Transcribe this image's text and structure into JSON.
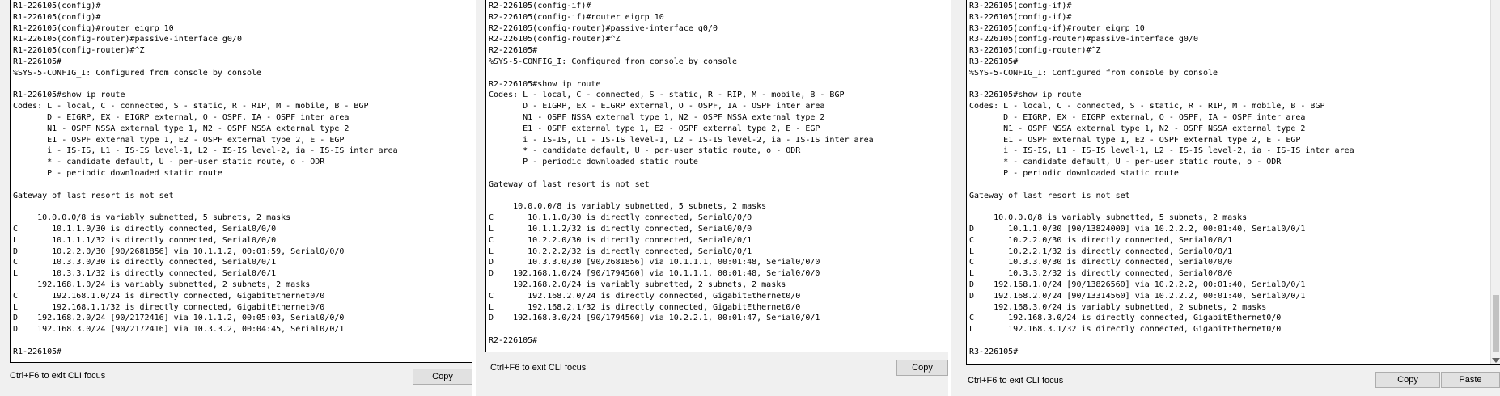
{
  "panels": [
    {
      "id": "R1",
      "terminal_lines": [
        "R1-226105(config)#",
        "R1-226105(config)#",
        "R1-226105(config)#router eigrp 10",
        "R1-226105(config-router)#passive-interface g0/0",
        "R1-226105(config-router)#^Z",
        "R1-226105#",
        "%SYS-5-CONFIG_I: Configured from console by console",
        "",
        "R1-226105#show ip route",
        "Codes: L - local, C - connected, S - static, R - RIP, M - mobile, B - BGP",
        "       D - EIGRP, EX - EIGRP external, O - OSPF, IA - OSPF inter area",
        "       N1 - OSPF NSSA external type 1, N2 - OSPF NSSA external type 2",
        "       E1 - OSPF external type 1, E2 - OSPF external type 2, E - EGP",
        "       i - IS-IS, L1 - IS-IS level-1, L2 - IS-IS level-2, ia - IS-IS inter area",
        "       * - candidate default, U - per-user static route, o - ODR",
        "       P - periodic downloaded static route",
        "",
        "Gateway of last resort is not set",
        "",
        "     10.0.0.0/8 is variably subnetted, 5 subnets, 2 masks",
        "C       10.1.1.0/30 is directly connected, Serial0/0/0",
        "L       10.1.1.1/32 is directly connected, Serial0/0/0",
        "D       10.2.2.0/30 [90/2681856] via 10.1.1.2, 00:01:59, Serial0/0/0",
        "C       10.3.3.0/30 is directly connected, Serial0/0/1",
        "L       10.3.3.1/32 is directly connected, Serial0/0/1",
        "     192.168.1.0/24 is variably subnetted, 2 subnets, 2 masks",
        "C       192.168.1.0/24 is directly connected, GigabitEthernet0/0",
        "L       192.168.1.1/32 is directly connected, GigabitEthernet0/0",
        "D    192.168.2.0/24 [90/2172416] via 10.1.1.2, 00:05:03, Serial0/0/0",
        "D    192.168.3.0/24 [90/2172416] via 10.3.3.2, 00:04:45, Serial0/0/1",
        "",
        "R1-226105#"
      ],
      "hint": "Ctrl+F6 to exit CLI focus",
      "copy_label": "Copy"
    },
    {
      "id": "R2",
      "terminal_lines": [
        "R2-226105(config-if)#",
        "R2-226105(config-if)#router eigrp 10",
        "R2-226105(config-router)#passive-interface g0/0",
        "R2-226105(config-router)#^Z",
        "R2-226105#",
        "%SYS-5-CONFIG_I: Configured from console by console",
        "",
        "R2-226105#show ip route",
        "Codes: L - local, C - connected, S - static, R - RIP, M - mobile, B - BGP",
        "       D - EIGRP, EX - EIGRP external, O - OSPF, IA - OSPF inter area",
        "       N1 - OSPF NSSA external type 1, N2 - OSPF NSSA external type 2",
        "       E1 - OSPF external type 1, E2 - OSPF external type 2, E - EGP",
        "       i - IS-IS, L1 - IS-IS level-1, L2 - IS-IS level-2, ia - IS-IS inter area",
        "       * - candidate default, U - per-user static route, o - ODR",
        "       P - periodic downloaded static route",
        "",
        "Gateway of last resort is not set",
        "",
        "     10.0.0.0/8 is variably subnetted, 5 subnets, 2 masks",
        "C       10.1.1.0/30 is directly connected, Serial0/0/0",
        "L       10.1.1.2/32 is directly connected, Serial0/0/0",
        "C       10.2.2.0/30 is directly connected, Serial0/0/1",
        "L       10.2.2.2/32 is directly connected, Serial0/0/1",
        "D       10.3.3.0/30 [90/2681856] via 10.1.1.1, 00:01:48, Serial0/0/0",
        "D    192.168.1.0/24 [90/1794560] via 10.1.1.1, 00:01:48, Serial0/0/0",
        "     192.168.2.0/24 is variably subnetted, 2 subnets, 2 masks",
        "C       192.168.2.0/24 is directly connected, GigabitEthernet0/0",
        "L       192.168.2.1/32 is directly connected, GigabitEthernet0/0",
        "D    192.168.3.0/24 [90/1794560] via 10.2.2.1, 00:01:47, Serial0/0/1",
        "",
        "R2-226105#"
      ],
      "hint": "Ctrl+F6 to exit CLI focus",
      "copy_label": "Copy"
    },
    {
      "id": "R3",
      "terminal_lines": [
        "R3-226105(config-if)#",
        "R3-226105(config-if)#",
        "R3-226105(config-if)#router eigrp 10",
        "R3-226105(config-router)#passive-interface g0/0",
        "R3-226105(config-router)#^Z",
        "R3-226105#",
        "%SYS-5-CONFIG_I: Configured from console by console",
        "",
        "R3-226105#show ip route",
        "Codes: L - local, C - connected, S - static, R - RIP, M - mobile, B - BGP",
        "       D - EIGRP, EX - EIGRP external, O - OSPF, IA - OSPF inter area",
        "       N1 - OSPF NSSA external type 1, N2 - OSPF NSSA external type 2",
        "       E1 - OSPF external type 1, E2 - OSPF external type 2, E - EGP",
        "       i - IS-IS, L1 - IS-IS level-1, L2 - IS-IS level-2, ia - IS-IS inter area",
        "       * - candidate default, U - per-user static route, o - ODR",
        "       P - periodic downloaded static route",
        "",
        "Gateway of last resort is not set",
        "",
        "     10.0.0.0/8 is variably subnetted, 5 subnets, 2 masks",
        "D       10.1.1.0/30 [90/13824000] via 10.2.2.2, 00:01:40, Serial0/0/1",
        "C       10.2.2.0/30 is directly connected, Serial0/0/1",
        "L       10.2.2.1/32 is directly connected, Serial0/0/1",
        "C       10.3.3.0/30 is directly connected, Serial0/0/0",
        "L       10.3.3.2/32 is directly connected, Serial0/0/0",
        "D    192.168.1.0/24 [90/13826560] via 10.2.2.2, 00:01:40, Serial0/0/1",
        "D    192.168.2.0/24 [90/13314560] via 10.2.2.2, 00:01:40, Serial0/0/1",
        "     192.168.3.0/24 is variably subnetted, 2 subnets, 2 masks",
        "C       192.168.3.0/24 is directly connected, GigabitEthernet0/0",
        "L       192.168.3.1/32 is directly connected, GigabitEthernet0/0",
        "",
        "R3-226105#"
      ],
      "hint": "Ctrl+F6 to exit CLI focus",
      "copy_label": "Copy",
      "paste_label": "Paste"
    }
  ]
}
